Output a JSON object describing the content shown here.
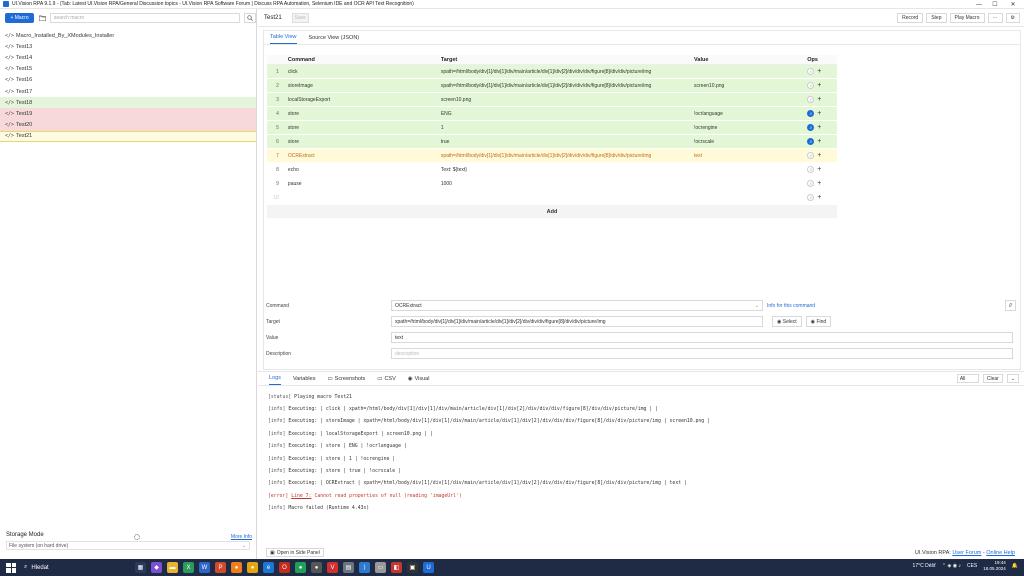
{
  "window": {
    "title": "UI.Vision RPA 9.1.9 - (Tab: Latest UI.Vision RPA/General Discussion topics - UI.Vision RPA Software Forum | Discuss RPA Automation, Selenium IDE and OCR API Text Recognition)",
    "controls": [
      "—",
      "☐",
      "✕"
    ]
  },
  "sidebar": {
    "new_macro": "+ Macro",
    "search_placeholder": "search macro",
    "macros": [
      {
        "name": "Macro_Installed_By_XModules_Installer",
        "status": "none"
      },
      {
        "name": "Test13",
        "status": "none"
      },
      {
        "name": "Test14",
        "status": "none"
      },
      {
        "name": "Test15",
        "status": "none"
      },
      {
        "name": "Test16",
        "status": "none"
      },
      {
        "name": "Test17",
        "status": "none"
      },
      {
        "name": "Test18",
        "status": "success"
      },
      {
        "name": "Test19",
        "status": "error"
      },
      {
        "name": "Test20",
        "status": "error"
      },
      {
        "name": "Test21",
        "status": "current"
      }
    ],
    "storage_mode_label": "Storage Mode",
    "more_info": "More Info",
    "storage_value": "File system (on hard drive)"
  },
  "toolbar": {
    "macro_name": "Test21",
    "save_label": "Save",
    "record_label": "Record",
    "step_label": "Step",
    "play_label": "Play Macro",
    "more_label": "···"
  },
  "editor_tabs": [
    "Table View",
    "Source View (JSON)"
  ],
  "table": {
    "headers": {
      "command": "Command",
      "target": "Target",
      "value": "Value",
      "ops": "Ops"
    },
    "rows": [
      {
        "num": "1",
        "command": "click",
        "target": "xpath=/html/body/div[1]/div[1]/div/main/article/div[1]/div[2]/div/div/div/figure[8]/div/div/picture/img",
        "value": "",
        "state": "green",
        "bp": false
      },
      {
        "num": "2",
        "command": "storeImage",
        "target": "xpath=/html/body/div[1]/div[1]/div/main/article/div[1]/div[2]/div/div/div/figure[8]/div/div/picture/img",
        "value": "screen10.png",
        "state": "green",
        "bp": false
      },
      {
        "num": "3",
        "command": "localStorageExport",
        "target": "screen10.png",
        "value": "",
        "state": "green",
        "bp": false
      },
      {
        "num": "4",
        "command": "store",
        "target": "ENG",
        "value": "!ocrlanguage",
        "state": "green",
        "bp": true
      },
      {
        "num": "5",
        "command": "store",
        "target": "1",
        "value": "!ocrengine",
        "state": "green",
        "bp": true
      },
      {
        "num": "6",
        "command": "store",
        "target": "true",
        "value": "!ocrscale",
        "state": "green",
        "bp": true
      },
      {
        "num": "7",
        "command": "OCRExtract",
        "target": "xpath=/html/body/div[1]/div[1]/div/main/article/div[1]/div[2]/div/div/div/figure[8]/div/div/picture/img",
        "value": "text",
        "state": "yellow",
        "bp": false
      },
      {
        "num": "8",
        "command": "echo",
        "target": "Text: ${text}",
        "value": "",
        "state": "white",
        "bp": false
      },
      {
        "num": "9",
        "command": "pause",
        "target": "1000",
        "value": "",
        "state": "white",
        "bp": false
      },
      {
        "num": "10",
        "command": "",
        "target": "",
        "value": "",
        "state": "white",
        "bp": false
      }
    ],
    "op_comment": "//",
    "op_add": "+",
    "add_label": "Add"
  },
  "command_editor": {
    "command_label": "Command",
    "command_value": "OCRExtract",
    "info_link": "Info for this command",
    "target_label": "Target",
    "target_value": "xpath=/html/body/div[1]/div[1]/div/main/article/div[1]/div[2]/div/div/div/figure[8]/div/div/picture/img",
    "select_label": "Select",
    "find_label": "Find",
    "value_label": "Value",
    "value_value": "text",
    "description_label": "Description",
    "description_placeholder": "description",
    "comment_btn": "//"
  },
  "log_tabs": [
    "Logs",
    "Variables",
    "Screenshots",
    "CSV",
    "Visual"
  ],
  "log_filter": "All",
  "log_clear": "Clear",
  "logs": [
    {
      "level": "[status]",
      "text": "Playing macro Test21",
      "error": false
    },
    {
      "level": "[info]",
      "text": "Executing:  | click | xpath=/html/body/div[1]/div[1]/div/main/article/div[1]/div[2]/div/div/div/figure[8]/div/div/picture/img |  |",
      "error": false
    },
    {
      "level": "[info]",
      "text": "Executing:  | storeImage | xpath=/html/body/div[1]/div[1]/div/main/article/div[1]/div[2]/div/div/div/figure[8]/div/div/picture/img | screen10.png |",
      "error": false
    },
    {
      "level": "[info]",
      "text": "Executing:  | localStorageExport | screen10.png |  |",
      "error": false
    },
    {
      "level": "[info]",
      "text": "Executing:  | store | ENG | !ocrlanguage |",
      "error": false
    },
    {
      "level": "[info]",
      "text": "Executing:  | store | 1 | !ocrengine |",
      "error": false
    },
    {
      "level": "[info]",
      "text": "Executing:  | store | true | !ocrscale |",
      "error": false
    },
    {
      "level": "[info]",
      "text": "Executing:  | OCRExtract | xpath=/html/body/div[1]/div[1]/div/main/article/div[1]/div[2]/div/div/div/figure[8]/div/div/picture/img | text |",
      "error": false
    },
    {
      "level": "[error]",
      "link": "Line 7:",
      "text": "Cannot read properties of null (reading 'imageUrl')",
      "error": true
    },
    {
      "level": "[info]",
      "text": "Macro failed (Runtime 4.43s)",
      "error": false
    }
  ],
  "footer": {
    "side_panel": "Open in Side Panel",
    "brand": "UI.Vision RPA:",
    "forum": "User Forum",
    "separator": " - ",
    "help": "Online Help"
  },
  "taskbar": {
    "search": "Hledat",
    "weather": "17°C  Déšť",
    "lang": "CES",
    "time": "19:44",
    "date": "18.05.2024"
  },
  "colors": {
    "accent": "#1e6bd6",
    "row_success": "#e3f7d6",
    "row_current": "#fffbd9",
    "row_error": "#f7d9da"
  }
}
